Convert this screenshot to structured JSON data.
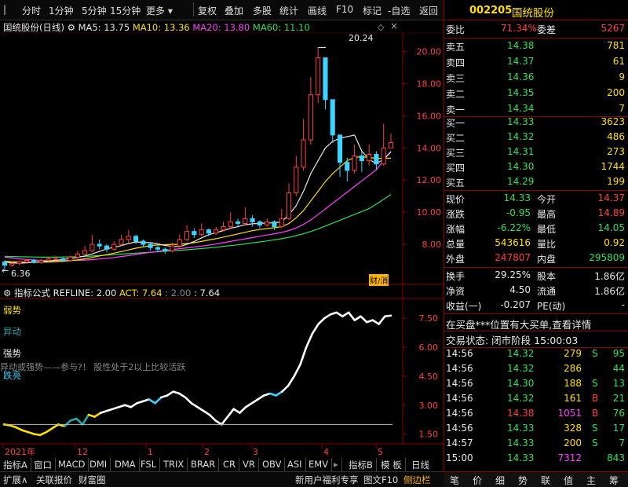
{
  "toolbar": {
    "items": [
      "分时",
      "1分钟",
      "5分钟",
      "15分钟",
      "更多",
      "复权",
      "叠加",
      "多股",
      "统计",
      "画线",
      "F10",
      "标记",
      "-自选",
      "返回"
    ]
  },
  "chart_header": {
    "stock": "国统股份(日线)",
    "ma5": "MA5: 13.75",
    "ma10": "MA10: 13.36",
    "ma20": "MA20: 13.80",
    "ma60": "MA60: 11.10",
    "peak_label": "20.24",
    "low_label": "6.36",
    "badge": "财/消"
  },
  "chart_data": {
    "type": "line",
    "ylim": [
      6.0,
      21.0
    ],
    "yticks": [
      "20.00",
      "18.00",
      "16.00",
      "14.00",
      "12.00",
      "10.00",
      "8.00"
    ],
    "indicator_yticks": [
      "7.50",
      "6.00",
      "4.50",
      "3.00",
      "1.50"
    ],
    "indicator_ylim": [
      1.2,
      8.2
    ],
    "xticks": [
      "2021年",
      "12",
      "1",
      "2",
      "3",
      "4",
      "5"
    ],
    "candles": [
      [
        6.9,
        6.7,
        7.0,
        6.36
      ],
      [
        6.7,
        6.8,
        6.9,
        6.6
      ],
      [
        6.8,
        6.9,
        7.0,
        6.7
      ],
      [
        6.9,
        7.0,
        7.1,
        6.8
      ],
      [
        7.0,
        6.9,
        7.1,
        6.8
      ],
      [
        6.9,
        7.0,
        7.1,
        6.8
      ],
      [
        7.0,
        7.1,
        7.2,
        6.9
      ],
      [
        7.1,
        7.1,
        7.3,
        7.0
      ],
      [
        7.1,
        7.0,
        7.2,
        6.9
      ],
      [
        7.0,
        7.2,
        7.3,
        7.0
      ],
      [
        7.2,
        7.4,
        7.6,
        7.1
      ],
      [
        7.4,
        7.6,
        7.9,
        7.3
      ],
      [
        7.6,
        8.0,
        8.6,
        7.5
      ],
      [
        8.0,
        7.9,
        8.3,
        7.7
      ],
      [
        7.9,
        7.7,
        8.0,
        7.5
      ],
      [
        7.7,
        8.0,
        8.2,
        7.6
      ],
      [
        8.0,
        8.3,
        8.6,
        7.9
      ],
      [
        8.3,
        8.5,
        8.9,
        8.1
      ],
      [
        8.5,
        8.2,
        8.6,
        8.0
      ],
      [
        8.2,
        8.0,
        8.3,
        7.8
      ],
      [
        8.0,
        7.8,
        8.1,
        7.6
      ],
      [
        7.8,
        7.7,
        7.9,
        7.5
      ],
      [
        7.7,
        7.6,
        7.8,
        7.4
      ],
      [
        7.6,
        7.9,
        8.1,
        7.5
      ],
      [
        7.9,
        8.3,
        8.6,
        7.8
      ],
      [
        8.3,
        8.8,
        9.2,
        8.2
      ],
      [
        8.8,
        8.6,
        9.0,
        8.4
      ],
      [
        8.6,
        8.9,
        9.3,
        8.5
      ],
      [
        8.9,
        8.7,
        9.0,
        8.5
      ],
      [
        8.7,
        8.9,
        9.1,
        8.6
      ],
      [
        8.9,
        9.1,
        9.4,
        8.8
      ],
      [
        9.1,
        9.4,
        10.0,
        9.0
      ],
      [
        9.4,
        9.3,
        9.6,
        9.1
      ],
      [
        9.3,
        9.6,
        10.3,
        9.2
      ],
      [
        9.6,
        9.4,
        9.8,
        9.1
      ],
      [
        9.4,
        9.2,
        9.5,
        9.0
      ],
      [
        9.2,
        9.4,
        9.6,
        9.1
      ],
      [
        9.4,
        9.1,
        9.5,
        8.9
      ],
      [
        9.1,
        9.6,
        10.2,
        9.0
      ],
      [
        9.6,
        11.2,
        11.8,
        9.5
      ],
      [
        11.2,
        12.8,
        13.5,
        11.0
      ],
      [
        12.8,
        14.5,
        15.8,
        12.6
      ],
      [
        14.5,
        17.3,
        18.4,
        14.2
      ],
      [
        17.3,
        19.6,
        20.24,
        16.8
      ],
      [
        19.6,
        17.0,
        18.8,
        16.4
      ],
      [
        17.0,
        14.8,
        16.9,
        14.3
      ],
      [
        14.8,
        13.1,
        14.6,
        12.2
      ],
      [
        13.1,
        12.6,
        13.4,
        11.9
      ],
      [
        12.6,
        13.5,
        14.2,
        12.4
      ],
      [
        13.5,
        13.2,
        13.8,
        12.5
      ],
      [
        13.2,
        13.6,
        14.2,
        12.9
      ],
      [
        13.6,
        13.0,
        13.8,
        12.6
      ],
      [
        13.0,
        14.0,
        15.5,
        12.9
      ],
      [
        14.0,
        14.33,
        14.89,
        14.05
      ]
    ],
    "ma5": [
      6.9,
      6.85,
      6.83,
      6.85,
      6.9,
      6.92,
      6.96,
      7.0,
      7.06,
      7.12,
      7.18,
      7.28,
      7.4,
      7.56,
      7.72,
      7.82,
      7.92,
      8.05,
      8.15,
      8.12,
      8.1,
      8.03,
      7.93,
      7.87,
      7.86,
      8.0,
      8.18,
      8.4,
      8.6,
      8.72,
      8.86,
      9.0,
      9.1,
      9.22,
      9.28,
      9.3,
      9.33,
      9.33,
      9.4,
      9.84,
      10.4,
      11.3,
      12.4,
      13.2,
      14.0,
      14.4,
      14.6,
      14.7,
      14.8,
      13.8,
      13.3,
      13.0,
      13.3,
      13.75
    ],
    "ma10": [
      6.95,
      6.92,
      6.9,
      6.89,
      6.88,
      6.89,
      6.9,
      6.92,
      6.95,
      6.98,
      7.03,
      7.1,
      7.18,
      7.28,
      7.36,
      7.45,
      7.55,
      7.65,
      7.76,
      7.84,
      7.92,
      7.96,
      7.98,
      8.0,
      8.0,
      8.05,
      8.1,
      8.18,
      8.27,
      8.35,
      8.45,
      8.55,
      8.65,
      8.75,
      8.85,
      8.92,
      8.98,
      9.03,
      9.1,
      9.3,
      9.65,
      10.1,
      10.7,
      11.3,
      11.9,
      12.4,
      12.8,
      13.2,
      13.4,
      13.45,
      13.4,
      13.35,
      13.35,
      13.36
    ],
    "ma20": [
      7.2,
      7.15,
      7.1,
      7.06,
      7.03,
      7.0,
      6.99,
      6.98,
      6.98,
      6.99,
      7.0,
      7.02,
      7.05,
      7.09,
      7.13,
      7.18,
      7.24,
      7.3,
      7.37,
      7.44,
      7.5,
      7.56,
      7.62,
      7.68,
      7.73,
      7.78,
      7.83,
      7.89,
      7.95,
      8.02,
      8.1,
      8.18,
      8.26,
      8.34,
      8.42,
      8.5,
      8.58,
      8.66,
      8.74,
      8.86,
      9.02,
      9.24,
      9.52,
      9.85,
      10.2,
      10.55,
      10.9,
      11.25,
      11.6,
      11.95,
      12.3,
      12.65,
      13.2,
      13.8
    ],
    "ma60": [
      7.25,
      7.24,
      7.23,
      7.22,
      7.21,
      7.2,
      7.2,
      7.2,
      7.21,
      7.22,
      7.23,
      7.25,
      7.27,
      7.3,
      7.33,
      7.36,
      7.39,
      7.42,
      7.45,
      7.48,
      7.51,
      7.54,
      7.57,
      7.6,
      7.63,
      7.66,
      7.7,
      7.74,
      7.78,
      7.82,
      7.87,
      7.92,
      7.97,
      8.03,
      8.09,
      8.15,
      8.21,
      8.28,
      8.35,
      8.44,
      8.54,
      8.66,
      8.8,
      8.96,
      9.14,
      9.32,
      9.5,
      9.68,
      9.86,
      10.04,
      10.22,
      10.5,
      10.8,
      11.1
    ],
    "indicator": {
      "name": "指标公式",
      "refline": "REFLINE: 2.00",
      "act": "ACT: 7.64",
      "extra_a": ": 2.00",
      "extra_b": ": 7.64",
      "refline_value": 2.0,
      "values": [
        2.0,
        1.95,
        1.85,
        1.7,
        1.6,
        1.5,
        1.45,
        1.6,
        1.8,
        2.0,
        1.9,
        2.2,
        2.3,
        2.0,
        2.5,
        2.4,
        2.6,
        2.7,
        2.8,
        2.9,
        3.0,
        2.9,
        3.1,
        3.2,
        3.3,
        3.1,
        3.4,
        3.5,
        3.7,
        3.6,
        3.4,
        3.1,
        2.9,
        2.7,
        2.5,
        2.2,
        2.0,
        2.4,
        2.8,
        2.6,
        2.9,
        3.1,
        3.3,
        3.5,
        3.6,
        3.5,
        3.7,
        4.0,
        4.5,
        5.1,
        6.0,
        6.7,
        7.2,
        7.5,
        7.7,
        7.8,
        7.6,
        7.8,
        7.4,
        7.6,
        7.3,
        7.4,
        7.2,
        7.6,
        7.64
      ]
    },
    "state_labels": [
      "弱势",
      "异动",
      "强势",
      "异动或强势——参与?！ 股性处于2以上比较活跃",
      "跌亮"
    ]
  },
  "quote": {
    "code": "002205",
    "name": "国统股份",
    "wb_label": "委比",
    "wb_value": "71.34%",
    "wc_label": "委差",
    "wc_value": "5267",
    "sells": [
      {
        "label": "卖五",
        "price": "14.38",
        "vol": "781"
      },
      {
        "label": "卖四",
        "price": "14.37",
        "vol": "61"
      },
      {
        "label": "卖三",
        "price": "14.36",
        "vol": "9"
      },
      {
        "label": "卖二",
        "price": "14.35",
        "vol": "200"
      },
      {
        "label": "卖一",
        "price": "14.34",
        "vol": "7"
      }
    ],
    "buys": [
      {
        "label": "买一",
        "price": "14.33",
        "vol": "3623"
      },
      {
        "label": "买二",
        "price": "14.32",
        "vol": "486"
      },
      {
        "label": "买三",
        "price": "14.31",
        "vol": "273"
      },
      {
        "label": "买四",
        "price": "14.30",
        "vol": "1744"
      },
      {
        "label": "买五",
        "price": "14.29",
        "vol": "199"
      }
    ],
    "stats": [
      {
        "l1": "现价",
        "v1": "14.33",
        "l2": "今开",
        "v2": "14.37"
      },
      {
        "l1": "涨跌",
        "v1": "-0.95",
        "l2": "最高",
        "v2": "14.89"
      },
      {
        "l1": "涨幅",
        "v1": "-6.22%",
        "l2": "最低",
        "v2": "14.05"
      },
      {
        "l1": "总量",
        "v1": "543616",
        "l2": "量比",
        "v2": "0.92"
      },
      {
        "l1": "外盘",
        "v1": "247807",
        "l2": "内盘",
        "v2": "295809"
      }
    ],
    "stats2": [
      {
        "l1": "换手",
        "v1": "29.25%",
        "l2": "股本",
        "v2": "1.86亿"
      },
      {
        "l1": "净资",
        "v1": "4.50",
        "l2": "流通",
        "v2": "1.86亿"
      },
      {
        "l1": "收益(一)",
        "v1": "-0.207",
        "l2": "PE(动)",
        "v2": "-"
      }
    ],
    "notice": "在买盘***位置有大买单,查看详情",
    "status": "交易状态: 闭市阶段 15:00:03",
    "ticks": [
      {
        "t": "14:56",
        "p": "14.32",
        "v": "279",
        "d": "S",
        "n": "95"
      },
      {
        "t": "14:56",
        "p": "14.32",
        "v": "286",
        "d": "",
        "n": "44"
      },
      {
        "t": "14:56",
        "p": "14.30",
        "v": "188",
        "d": "S",
        "n": "13"
      },
      {
        "t": "14:56",
        "p": "14.32",
        "v": "161",
        "d": "B",
        "n": "21"
      },
      {
        "t": "14:56",
        "p": "14.38",
        "v": "1051",
        "d": "B",
        "n": "76"
      },
      {
        "t": "14:56",
        "p": "14.33",
        "v": "328",
        "d": "S",
        "n": "17"
      },
      {
        "t": "14:57",
        "p": "14.33",
        "v": "200",
        "d": "S",
        "n": "7"
      },
      {
        "t": "15:00",
        "p": "14.33",
        "v": "7312",
        "d": "",
        "n": "843"
      }
    ]
  },
  "bottom": {
    "tabs": [
      "指标A",
      "窗口",
      "MACD",
      "DMI",
      "DMA",
      "FSL",
      "TRIX",
      "BRAR",
      "CR",
      "VR",
      "OBV",
      "ASI",
      "EMV",
      "指标B",
      "模",
      "板"
    ],
    "period": "日线",
    "row2": [
      "扩展∧",
      "关联报价",
      "财富圈"
    ],
    "news": "新用户福利专享",
    "f10": "图文F10",
    "side": "侧边栏",
    "right_tabs": [
      "笔",
      "价",
      "细",
      "势",
      "联",
      "值",
      "主",
      "筹"
    ]
  },
  "colors": {
    "up": "#ff4040",
    "down": "#2fe05a",
    "ma5": "#e8e8e8",
    "ma10": "#ffe000",
    "ma20": "#ff40ff",
    "ma60": "#2fe05a",
    "border": "#8b0000"
  }
}
